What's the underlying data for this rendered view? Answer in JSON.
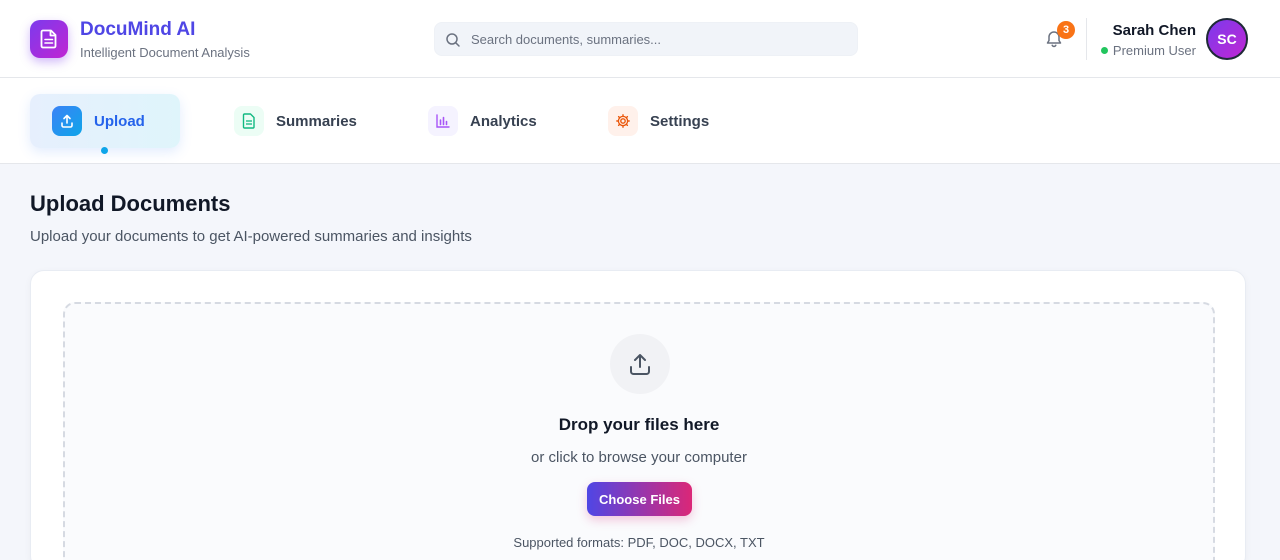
{
  "brand": {
    "name": "DocuMind AI",
    "tagline": "Intelligent Document Analysis",
    "icon": "document-icon",
    "accent": "#4f46e5"
  },
  "search": {
    "placeholder": "Search documents, summaries..."
  },
  "notifications": {
    "count": "3",
    "icon": "bell-icon",
    "badge_color": "#f97316"
  },
  "user": {
    "name": "Sarah Chen",
    "plan": "Premium User",
    "initials": "SC",
    "status_color": "#22c55e"
  },
  "tabs": [
    {
      "label": "Upload",
      "icon": "upload-icon",
      "active": true
    },
    {
      "label": "Summaries",
      "icon": "file-text-icon",
      "active": false
    },
    {
      "label": "Analytics",
      "icon": "bar-chart-icon",
      "active": false
    },
    {
      "label": "Settings",
      "icon": "gear-icon",
      "active": false
    }
  ],
  "main": {
    "title": "Upload Documents",
    "subtitle": "Upload your documents to get AI-powered summaries and insights",
    "dropzone": {
      "title": "Drop your files here",
      "subtitle": "or click to browse your computer",
      "button_label": "Choose Files",
      "formats": "Supported formats: PDF, DOC, DOCX, TXT"
    }
  }
}
